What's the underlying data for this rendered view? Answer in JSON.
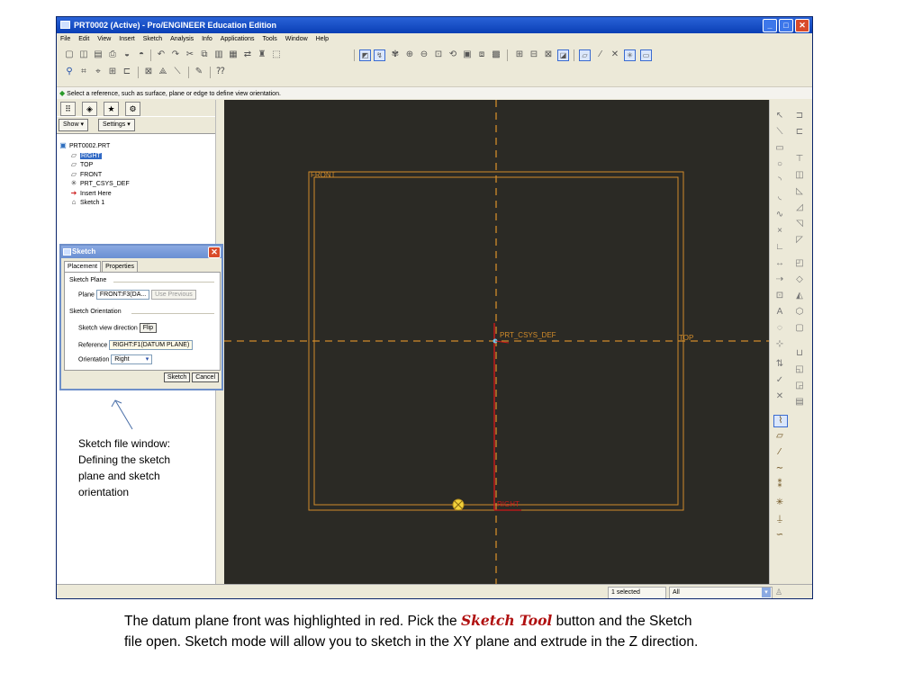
{
  "window": {
    "title": "PRT0002 (Active) - Pro/ENGINEER Education Edition",
    "controls": [
      "_",
      "□",
      "✕"
    ]
  },
  "menu": [
    "File",
    "Edit",
    "View",
    "Insert",
    "Sketch",
    "Analysis",
    "Info",
    "Applications",
    "Tools",
    "Window",
    "Help"
  ],
  "message": "Select a reference, such as surface, plane or edge to define view orientation.",
  "left_pane": {
    "show_button": "Show ▾",
    "settings_button": "Settings ▾",
    "tree": [
      {
        "label": "PRT0002.PRT",
        "icon": "part-icon",
        "glyph": "▣",
        "selected": false
      },
      {
        "label": "RIGHT",
        "icon": "datum-plane-icon",
        "glyph": "▱",
        "selected": true
      },
      {
        "label": "TOP",
        "icon": "datum-plane-icon",
        "glyph": "▱",
        "selected": false
      },
      {
        "label": "FRONT",
        "icon": "datum-plane-icon",
        "glyph": "▱",
        "selected": false
      },
      {
        "label": "PRT_CSYS_DEF",
        "icon": "csys-icon",
        "glyph": "✳",
        "selected": false
      },
      {
        "label": "Insert Here",
        "icon": "insert-here-icon",
        "glyph": "➔",
        "selected": false
      },
      {
        "label": "Sketch 1",
        "icon": "sketch-icon",
        "glyph": "⌂",
        "selected": false
      }
    ]
  },
  "sketch_dialog": {
    "title": "Sketch",
    "tabs": [
      "Placement",
      "Properties"
    ],
    "sketch_plane_label": "Sketch Plane",
    "plane_label": "Plane",
    "plane_value": "FRONT:F3(DA...",
    "use_previous": "Use Previous",
    "orientation_group": "Sketch Orientation",
    "view_direction_label": "Sketch view direction",
    "flip_button": "Flip",
    "reference_label": "Reference",
    "reference_value": "RIGHT:F1(DATUM PLANE)",
    "orientation_label": "Orientation",
    "orientation_value": "Right",
    "sketch_button": "Sketch",
    "cancel_button": "Cancel"
  },
  "canvas": {
    "front_label": "FRONT",
    "top_label": "TOP",
    "right_label": "RIGHT",
    "csys_label": "PRT_CSYS_DEF",
    "colors": {
      "background": "#2b2a25",
      "datum": "#d18b2a",
      "highlight": "#d01818"
    }
  },
  "status": {
    "selected": "1 selected",
    "filter": "All"
  },
  "annotation": "Sketch file window:  Defining the sketch plane and sketch orientation",
  "caption": {
    "part1": "The datum plane front was highlighted in red.  Pick the ",
    "tool": "Sketch Tool",
    "part2": " button and the Sketch file open.  Sketch mode will allow you to sketch in the XY plane and extrude in the Z direction."
  }
}
